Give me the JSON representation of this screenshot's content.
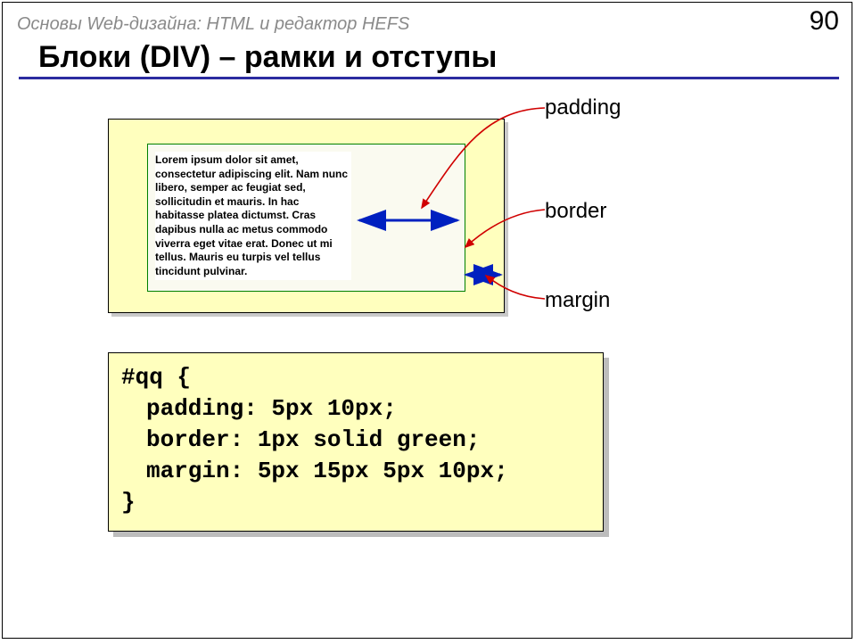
{
  "header": {
    "doc_title": "Основы Web-дизайна: HTML и редактор HEFS",
    "page_number": "90"
  },
  "slide_title": "Блоки (DIV) – рамки и отступы",
  "labels": {
    "padding": "padding",
    "border": "border",
    "margin": "margin"
  },
  "sample_text": "Lorem ipsum dolor sit amet, consectetur adipiscing elit. Nam nunc libero, semper ac feugiat sed, sollicitudin et mauris. In hac habitasse platea dictumst. Cras dapibus nulla ac metus commodo viverra eget vitae erat. Donec ut mi tellus. Mauris eu turpis vel tellus tincidunt pulvinar.",
  "code": {
    "open": "#qq {",
    "l1": "padding: 5px 10px;",
    "l2": "border: 1px solid green;",
    "l3": "margin: 5px 15px 5px 10px;",
    "close": "}"
  }
}
